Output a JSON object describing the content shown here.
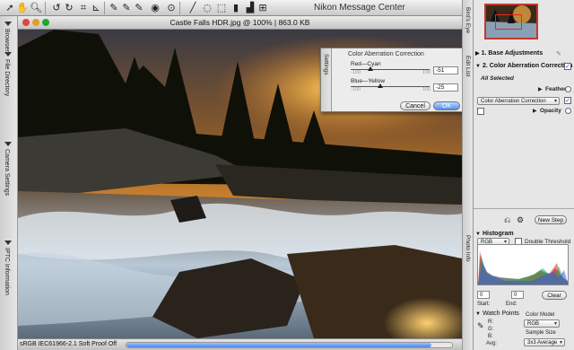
{
  "app": {
    "title": "Nikon Message Center"
  },
  "toolbar": {
    "icons": [
      "arrow-cursor-icon",
      "hand-icon",
      "zoom-icon",
      "rotate-left-icon",
      "rotate-right-icon",
      "crop-icon",
      "straighten-icon",
      "eyedropper-white-icon",
      "eyedropper-gray-icon",
      "eyedropper-black-icon",
      "red-eye-icon",
      "brush-icon",
      "lasso-icon",
      "selection-icon",
      "compare-icon",
      "tone-icon",
      "histogram-icon",
      "grid-icon"
    ]
  },
  "left_tabs": {
    "browser": "Browser",
    "file_directory": "File Directory",
    "camera_settings": "Camera Settings",
    "iptc_information": "IPTC Information"
  },
  "image_window": {
    "title": "Castle Falls HDR.jpg @ 100% | 863.0 KB",
    "status": "sRGB IEC61966-2.1   Soft Proof Off"
  },
  "dialog": {
    "side_label": "Settings",
    "title": "Color Aberration Correction",
    "red_cyan": {
      "label": "Red—Cyan",
      "min": "-100",
      "max": "100",
      "value": "-51"
    },
    "blue_yellow": {
      "label": "Blue—Yellow",
      "min": "-100",
      "max": "100",
      "value": "-25"
    },
    "cancel_label": "Cancel",
    "ok_label": "OK"
  },
  "right_tabs": {
    "birds_eye": "Bird's Eye",
    "edit_list": "Edit List",
    "photo_info": "Photo Info"
  },
  "edit_list": {
    "base_adjustments": "1. Base Adjustments",
    "color_aberration": "2. Color Aberration Correction",
    "all_selected": "All Selected",
    "feather": "Feather",
    "mode_select": "Color Aberration Correction",
    "opacity": "Opacity",
    "new_step": "New Step"
  },
  "photo_info": {
    "histogram_label": "Histogram",
    "channel": "RGB",
    "double_threshold": "Double Threshold",
    "start_value": "0",
    "end_value": "0",
    "start_label": "Start:",
    "end_label": "End:",
    "clear_label": "Clear",
    "watch_points": "Watch Points",
    "r_label": "R:",
    "g_label": "G:",
    "b_label": "B:",
    "avg_label": "Avg:",
    "color_model_label": "Color Model",
    "color_model": "RGB",
    "sample_size_label": "Sample Size",
    "sample_size": "3x3 Average"
  },
  "colors": {
    "accent_blue": "#4d8de8",
    "thumb_frame": "#c0392b"
  }
}
